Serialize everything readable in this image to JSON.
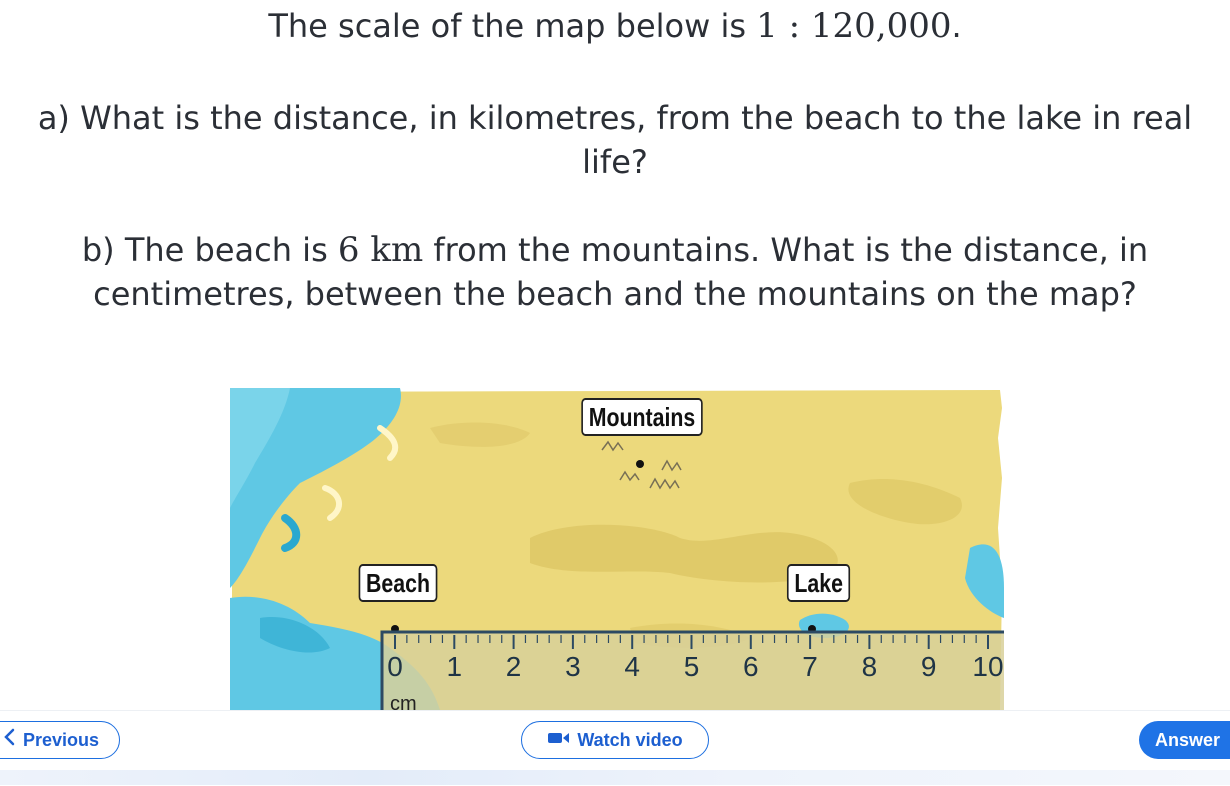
{
  "question": {
    "line1_pre": "The scale of the map below is",
    "line1_scale": "1 : 120,000",
    "line1_post": ".",
    "part_a": "a) What is the distance, in kilometres, from the beach to the lake in real life?",
    "part_b_pre": "b) The beach is",
    "part_b_value": "6 km",
    "part_b_post": "from the mountains. What is the distance, in centimetres, between the beach and the mountains on the map?"
  },
  "map": {
    "labels": {
      "mountains": "Mountains",
      "beach": "Beach",
      "lake": "Lake"
    },
    "ruler": {
      "ticks": [
        "0",
        "1",
        "2",
        "3",
        "4",
        "5",
        "6",
        "7",
        "8",
        "9",
        "10"
      ],
      "unit": "cm"
    },
    "colors": {
      "land": "#ecd97c",
      "land_dark": "#dcc463",
      "sea": "#5fc8e4",
      "sea_dark": "#2aa8cf",
      "ruler": "#d8d09a"
    }
  },
  "nav": {
    "previous": "Previous",
    "watch_video": "Watch video",
    "answer": "Answer"
  }
}
